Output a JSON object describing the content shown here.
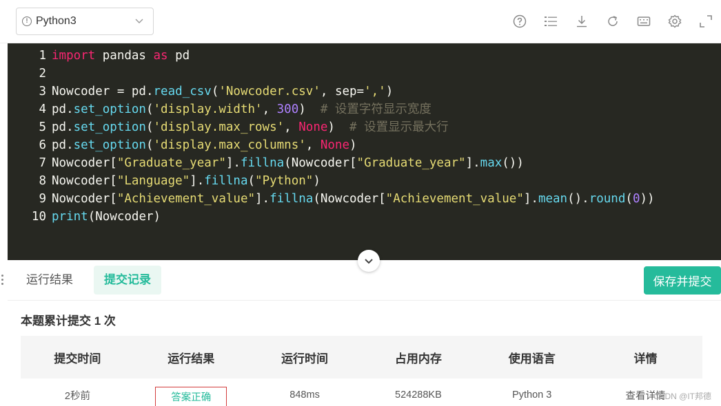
{
  "toolbar": {
    "language": "Python3",
    "icons": [
      "help-icon",
      "list-icon",
      "download-icon",
      "refresh-icon",
      "keyboard-icon",
      "settings-icon",
      "fullscreen-icon"
    ]
  },
  "editor": {
    "lines": [
      {
        "n": "1",
        "html": "<span class=\"kw\">import</span> pandas <span class=\"kw\">as</span> pd"
      },
      {
        "n": "2",
        "html": ""
      },
      {
        "n": "3",
        "html": "Nowcoder = pd.<span class=\"fn\">read_csv</span>(<span class=\"st\">'Nowcoder.csv'</span>, sep=<span class=\"st\">','</span>)"
      },
      {
        "n": "4",
        "html": "pd.<span class=\"fn\">set_option</span>(<span class=\"st\">'display.width'</span>, <span class=\"nm\">300</span>)  <span class=\"cm\"># 设置字符显示宽度</span>"
      },
      {
        "n": "5",
        "html": "pd.<span class=\"fn\">set_option</span>(<span class=\"st\">'display.max_rows'</span>, <span class=\"nn\">None</span>)  <span class=\"cm\"># 设置显示最大行</span>"
      },
      {
        "n": "6",
        "html": "pd.<span class=\"fn\">set_option</span>(<span class=\"st\">'display.max_columns'</span>, <span class=\"nn\">None</span>)"
      },
      {
        "n": "7",
        "html": "Nowcoder[<span class=\"st\">\"Graduate_year\"</span>].<span class=\"fn\">fillna</span>(Nowcoder[<span class=\"st\">\"Graduate_year\"</span>].<span class=\"fn\">max</span>())"
      },
      {
        "n": "8",
        "html": "Nowcoder[<span class=\"st\">\"Language\"</span>].<span class=\"fn\">fillna</span>(<span class=\"st\">\"Python\"</span>)"
      },
      {
        "n": "9",
        "html": "Nowcoder[<span class=\"st\">\"Achievement_value\"</span>].<span class=\"fn\">fillna</span>(Nowcoder[<span class=\"st\">\"Achievement_value\"</span>].<span class=\"fn\">mean</span>().<span class=\"fn\">round</span>(<span class=\"nm\">0</span>))"
      },
      {
        "n": "10",
        "html": "<span class=\"fn\">print</span>(Nowcoder)"
      }
    ]
  },
  "tabs": {
    "run_result": "运行结果",
    "submissions": "提交记录",
    "submit_button": "保存并提交"
  },
  "results": {
    "title": "本题累计提交 1 次",
    "headers": [
      "提交时间",
      "运行时间",
      "占用内存",
      "使用语言",
      "详情"
    ],
    "header_result": "运行结果",
    "row": {
      "time": "2秒前",
      "result": "答案正确",
      "runtime": "848ms",
      "memory": "524288KB",
      "language": "Python 3",
      "detail": "查看详情"
    }
  },
  "watermark": "CSDN @IT邦德",
  "colors": {
    "accent": "#25bb9b",
    "editor_bg": "#272822",
    "highlight_border": "#d23a3a"
  }
}
